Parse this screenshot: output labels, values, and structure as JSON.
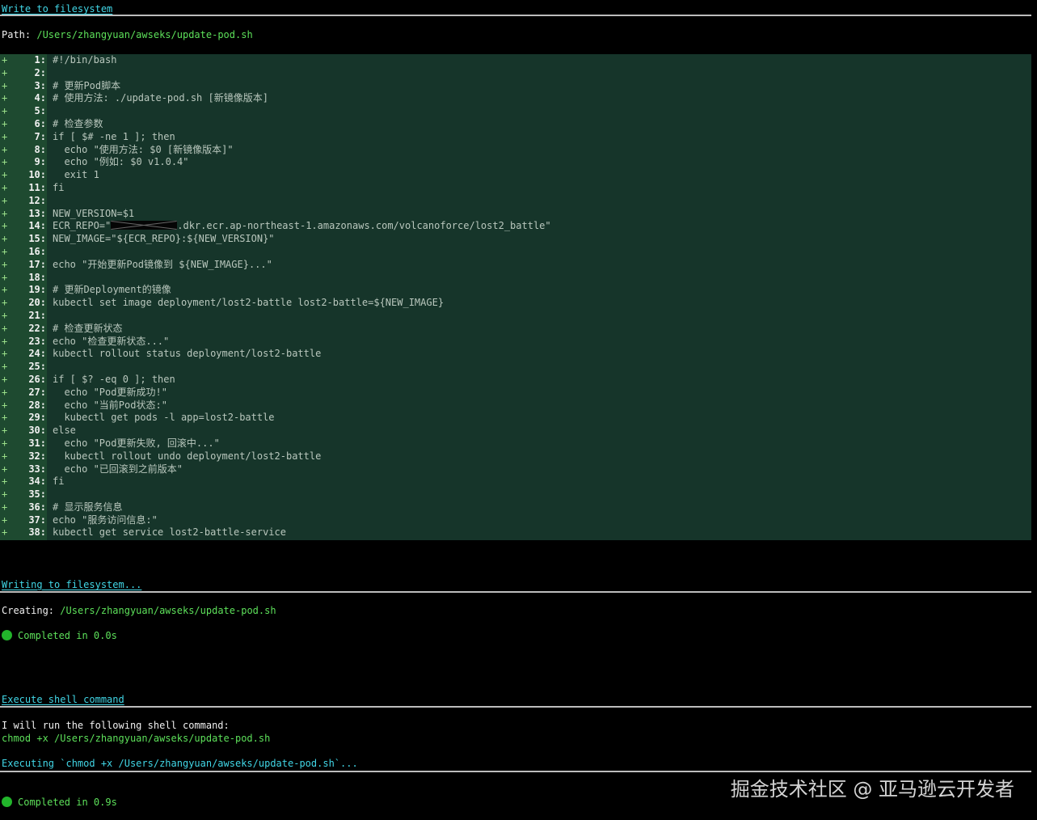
{
  "write_section": {
    "title": "Write to filesystem",
    "path_label": "Path:",
    "path": "/Users/zhangyuan/awseks/update-pod.sh"
  },
  "code": {
    "diff_marker": "+",
    "lines": [
      {
        "n": "1:",
        "text": "#!/bin/bash"
      },
      {
        "n": "2:",
        "text": ""
      },
      {
        "n": "3:",
        "text": "# 更新Pod脚本"
      },
      {
        "n": "4:",
        "text": "# 使用方法: ./update-pod.sh [新镜像版本]"
      },
      {
        "n": "5:",
        "text": ""
      },
      {
        "n": "6:",
        "text": "# 检查参数"
      },
      {
        "n": "7:",
        "text": "if [ $# -ne 1 ]; then"
      },
      {
        "n": "8:",
        "text": "  echo \"使用方法: $0 [新镜像版本]\""
      },
      {
        "n": "9:",
        "text": "  echo \"例如: $0 v1.0.4\""
      },
      {
        "n": "10:",
        "text": "  exit 1"
      },
      {
        "n": "11:",
        "text": "fi"
      },
      {
        "n": "12:",
        "text": ""
      },
      {
        "n": "13:",
        "text": "NEW_VERSION=$1"
      },
      {
        "n": "14:",
        "text": "ECR_REPO=\"",
        "redacted": true,
        "text_after": ".dkr.ecr.ap-northeast-1.amazonaws.com/volcanoforce/lost2_battle\""
      },
      {
        "n": "15:",
        "text": "NEW_IMAGE=\"${ECR_REPO}:${NEW_VERSION}\""
      },
      {
        "n": "16:",
        "text": ""
      },
      {
        "n": "17:",
        "text": "echo \"开始更新Pod镜像到 ${NEW_IMAGE}...\""
      },
      {
        "n": "18:",
        "text": ""
      },
      {
        "n": "19:",
        "text": "# 更新Deployment的镜像"
      },
      {
        "n": "20:",
        "text": "kubectl set image deployment/lost2-battle lost2-battle=${NEW_IMAGE}"
      },
      {
        "n": "21:",
        "text": ""
      },
      {
        "n": "22:",
        "text": "# 检查更新状态"
      },
      {
        "n": "23:",
        "text": "echo \"检查更新状态...\""
      },
      {
        "n": "24:",
        "text": "kubectl rollout status deployment/lost2-battle"
      },
      {
        "n": "25:",
        "text": ""
      },
      {
        "n": "26:",
        "text": "if [ $? -eq 0 ]; then"
      },
      {
        "n": "27:",
        "text": "  echo \"Pod更新成功!\""
      },
      {
        "n": "28:",
        "text": "  echo \"当前Pod状态:\""
      },
      {
        "n": "29:",
        "text": "  kubectl get pods -l app=lost2-battle"
      },
      {
        "n": "30:",
        "text": "else"
      },
      {
        "n": "31:",
        "text": "  echo \"Pod更新失败, 回滚中...\""
      },
      {
        "n": "32:",
        "text": "  kubectl rollout undo deployment/lost2-battle"
      },
      {
        "n": "33:",
        "text": "  echo \"已回滚到之前版本\""
      },
      {
        "n": "34:",
        "text": "fi"
      },
      {
        "n": "35:",
        "text": ""
      },
      {
        "n": "36:",
        "text": "# 显示服务信息"
      },
      {
        "n": "37:",
        "text": "echo \"服务访问信息:\""
      },
      {
        "n": "38:",
        "text": "kubectl get service lost2-battle-service"
      }
    ]
  },
  "writing_section": {
    "title": "Writing to filesystem...",
    "creating_label": "Creating:",
    "creating_path": "/Users/zhangyuan/awseks/update-pod.sh",
    "status": "Completed in 0.0s"
  },
  "execute_section": {
    "title": "Execute shell command",
    "intro": "I will run the following shell command:",
    "command": "chmod +x /Users/zhangyuan/awseks/update-pod.sh",
    "executing": "Executing `chmod +x /Users/zhangyuan/awseks/update-pod.sh`...",
    "status": "Completed in 0.9s"
  },
  "watermark": "掘金技术社区 @ 亚马逊云开发者",
  "colors": {
    "background": "#000000",
    "header_cyan": "#41d6e6",
    "path_green": "#5de05a",
    "code_bg": "#16352a",
    "gutter_bg": "#1e4a30",
    "status_dot": "#22b52b"
  }
}
